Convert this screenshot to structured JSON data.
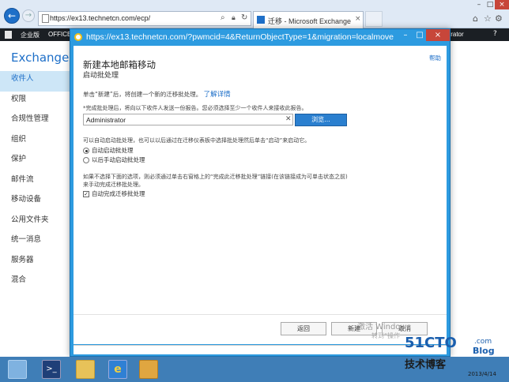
{
  "browser": {
    "address": "https://ex13.technetcn.com/ecp/",
    "tab_title": "迁移 - Microsoft Exchange",
    "tab_close": "×"
  },
  "office_bar": {
    "edition": "企业版",
    "office": "OFFICE",
    "user": "trator"
  },
  "app": {
    "title": "Exchange 管"
  },
  "left_nav": [
    {
      "label": "收件人",
      "selected": true
    },
    {
      "label": "权限"
    },
    {
      "label": "合规性管理"
    },
    {
      "label": "组织"
    },
    {
      "label": "保护"
    },
    {
      "label": "邮件流"
    },
    {
      "label": "移动设备"
    },
    {
      "label": "公用文件夹"
    },
    {
      "label": "统一消息"
    },
    {
      "label": "服务器"
    },
    {
      "label": "混合"
    }
  ],
  "dialog": {
    "url": "https://ex13.technetcn.com/?pwmcid=4&ReturnObjectType=1&migration=localmove",
    "help": "帮助",
    "wizard_title": "新建本地邮箱移动",
    "wizard_subtitle": "启动批处理",
    "intro": "单击“新建”后，将创建一个新的迁移批处理。",
    "learn_more": "了解详情",
    "report_text": "*完成批处理后，将向以下收件人发送一份报告。您必须选择至少一个收件人来接收此报告。",
    "recipient": "Administrator",
    "browse": "浏览...",
    "start_text": "可以自动启动批处理，也可以以后通过在迁移仪表板中选择批处理然后单击“启动”来启动它。",
    "radio_auto": "自动启动批处理",
    "radio_manual": "以后手动启动批处理",
    "complete_text": "如果不选择下面的选项，则必须通过单击右窗格上的“完成此迁移批处理”链接(在该链接成为可单击状态之前)来手动完成迁移批处理。",
    "auto_complete": "自动完成迁移批处理",
    "back": "返回",
    "new": "新建",
    "cancel": "取消"
  },
  "watermark": {
    "activate": "激活 Windows",
    "activate_sub": "转到“操作",
    "logo": "51CTO",
    "logo_com": ".com",
    "logo_blog": "Blog",
    "logo_text": "技术博客",
    "clock_time": "",
    "clock_date": "2013/4/14"
  },
  "colors": {
    "accent": "#1e6fc8",
    "dialog_frame": "#2d9be0",
    "taskbar": "#3f7eb7"
  }
}
